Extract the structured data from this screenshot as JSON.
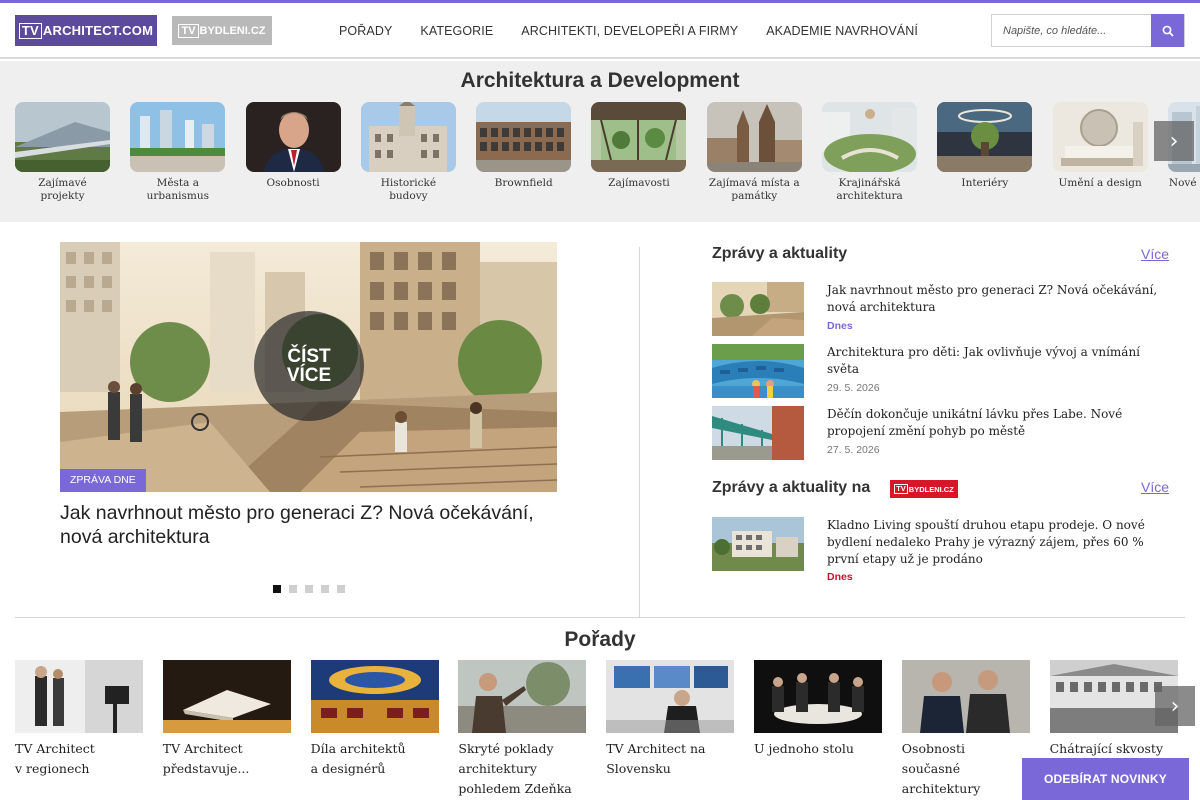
{
  "header": {
    "logo_tv": {
      "box": "TV",
      "text": "ARCHITECT.COM"
    },
    "logo_bydleni": {
      "box": "TV",
      "text": "BYDLENI.CZ"
    },
    "nav": [
      "POŘADY",
      "KATEGORIE",
      "ARCHITEKTI, DEVELOPEŘI A FIRMY",
      "AKADEMIE NAVRHOVÁNÍ"
    ],
    "search_placeholder": "Napište, co hledáte...",
    "accent": "#7b68d8"
  },
  "categories": {
    "title": "Architektura a Development",
    "items": [
      {
        "label": "Zajímavé projekty"
      },
      {
        "label": "Města a urbanismus"
      },
      {
        "label": "Osobnosti"
      },
      {
        "label": "Historické budovy"
      },
      {
        "label": "Brownfield"
      },
      {
        "label": "Zajímavosti"
      },
      {
        "label": "Zajímavá místa a památky"
      },
      {
        "label": "Krajinářská architektura"
      },
      {
        "label": "Interiéry"
      },
      {
        "label": "Umění a design"
      },
      {
        "label": "Nové technologie"
      }
    ],
    "next_icon": "chevron-right-icon"
  },
  "hero": {
    "read_more": [
      "ČÍST",
      "VÍCE"
    ],
    "badge": "ZPRÁVA DNE",
    "title": "Jak navrhnout město pro generaci Z? Nová očekávání, nová architektura",
    "slides": 5,
    "active_slide": 1
  },
  "news": {
    "heading": "Zprávy a aktuality",
    "more": "Více",
    "items": [
      {
        "title": "Jak navrhnout město pro generaci Z? Nová očekávání, nová architektura",
        "date": "Dnes"
      },
      {
        "title": "Architektura pro děti: Jak ovlivňuje vývoj a vnímání světa",
        "date": "29. 5. 2026"
      },
      {
        "title": "Děčín dokončuje unikátní lávku přes Labe. Nové propojení změní pohyb po městě",
        "date": "27. 5. 2026"
      }
    ]
  },
  "news2": {
    "heading": "Zprávy a aktuality na",
    "badge": {
      "box": "TV",
      "text": "BYDLENI.CZ"
    },
    "badge_color": "#d9152a",
    "more": "Více",
    "items": [
      {
        "title": "Kladno Living spouští druhou etapu prodeje. O nové bydlení nedaleko Prahy je výrazný zájem, přes 60 % první etapy už je prodáno",
        "date": "Dnes"
      }
    ]
  },
  "shows": {
    "title": "Pořady",
    "items": [
      {
        "lines": [
          "TV Architect",
          "v regionech"
        ]
      },
      {
        "lines": [
          "TV Architect",
          "představuje..."
        ]
      },
      {
        "lines": [
          "Díla architektů",
          "a designérů"
        ]
      },
      {
        "lines": [
          "Skryté poklady",
          "architektury",
          "pohledem Zdeňka"
        ]
      },
      {
        "lines": [
          "TV Architect na",
          "Slovensku"
        ]
      },
      {
        "lines": [
          "U jednoho stolu"
        ]
      },
      {
        "lines": [
          "Osobnosti",
          "současné",
          "architektury"
        ]
      },
      {
        "lines": [
          "Chátrající skvosty"
        ]
      }
    ],
    "next_icon": "chevron-right-icon"
  },
  "subscribe": "ODEBÍRAT NOVINKY"
}
